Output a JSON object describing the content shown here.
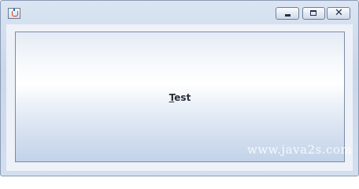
{
  "window": {
    "icon": "java-cup-icon",
    "controls": {
      "minimize_icon": "minimize-icon",
      "maximize_icon": "maximize-icon",
      "close_icon": "close-icon",
      "close_glyph": "✕"
    }
  },
  "button": {
    "mnemonic": "T",
    "label_rest": "est"
  },
  "watermark": "www.java2s.com"
}
